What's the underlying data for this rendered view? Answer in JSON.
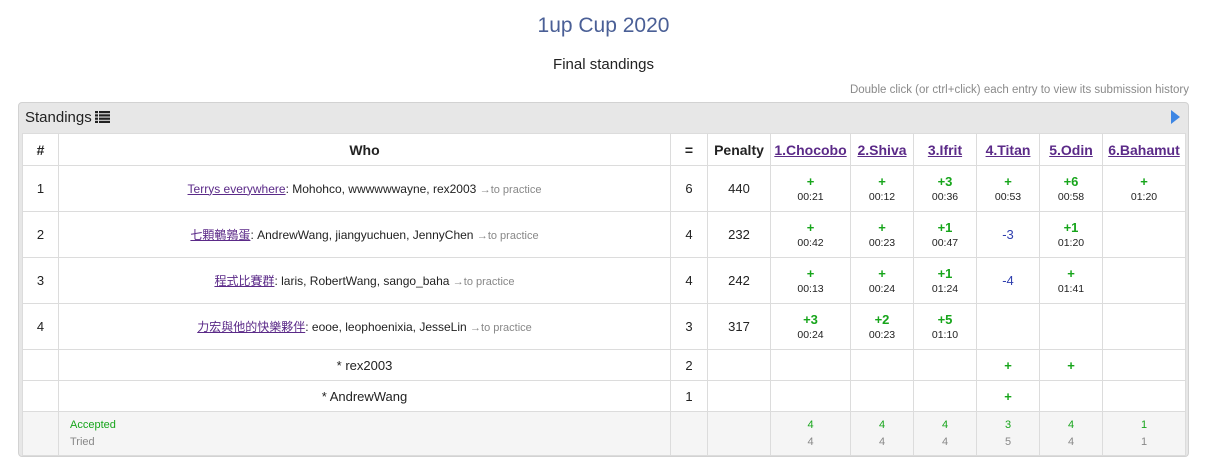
{
  "page": {
    "title": "1up Cup 2020",
    "subtitle": "Final standings",
    "hint": "Double click (or ctrl+click) each entry to view its submission history"
  },
  "panel": {
    "header": "Standings"
  },
  "columns": {
    "rank": "#",
    "who": "Who",
    "solved": "=",
    "penalty": "Penalty",
    "problems": [
      "1.Chocobo",
      "2.Shiva",
      "3.Ifrit",
      "4.Titan",
      "5.Odin",
      "6.Bahamut"
    ]
  },
  "rows": [
    {
      "rank": "1",
      "team": "Terrys everywhere",
      "members": ": Mohohco, wwwwwwayne, rex2003",
      "practice": "→to practice",
      "solved": "6",
      "penalty": "440",
      "cells": [
        {
          "res": "+",
          "time": "00:21"
        },
        {
          "res": "+",
          "time": "00:12"
        },
        {
          "res": "+3",
          "time": "00:36"
        },
        {
          "res": "+",
          "time": "00:53"
        },
        {
          "res": "+6",
          "time": "00:58"
        },
        {
          "res": "+",
          "time": "01:20"
        }
      ]
    },
    {
      "rank": "2",
      "team": "七顆鵪鶉蛋",
      "members": ": AndrewWang, jiangyuchuen, JennyChen",
      "practice": "→to practice",
      "solved": "4",
      "penalty": "232",
      "cells": [
        {
          "res": "+",
          "time": "00:42"
        },
        {
          "res": "+",
          "time": "00:23"
        },
        {
          "res": "+1",
          "time": "00:47"
        },
        {
          "res": "-3",
          "time": ""
        },
        {
          "res": "+1",
          "time": "01:20"
        },
        {
          "res": "",
          "time": ""
        }
      ]
    },
    {
      "rank": "3",
      "team": "程式比賽群",
      "members": ": laris, RobertWang, sango_baha",
      "practice": "→to practice",
      "solved": "4",
      "penalty": "242",
      "cells": [
        {
          "res": "+",
          "time": "00:13"
        },
        {
          "res": "+",
          "time": "00:24"
        },
        {
          "res": "+1",
          "time": "01:24"
        },
        {
          "res": "-4",
          "time": ""
        },
        {
          "res": "+",
          "time": "01:41"
        },
        {
          "res": "",
          "time": ""
        }
      ]
    },
    {
      "rank": "4",
      "team": "力宏與他的快樂夥伴",
      "members": ": eooe, leophoenixia, JesseLin",
      "practice": "→to practice",
      "solved": "3",
      "penalty": "317",
      "cells": [
        {
          "res": "+3",
          "time": "00:24"
        },
        {
          "res": "+2",
          "time": "00:23"
        },
        {
          "res": "+5",
          "time": "01:10"
        },
        {
          "res": "",
          "time": ""
        },
        {
          "res": "",
          "time": ""
        },
        {
          "res": "",
          "time": ""
        }
      ]
    }
  ],
  "individuals": [
    {
      "name": "* rex2003",
      "solved": "2",
      "cells": [
        "",
        "",
        "",
        "+",
        "+",
        ""
      ]
    },
    {
      "name": "* AndrewWang",
      "solved": "1",
      "cells": [
        "",
        "",
        "",
        "+",
        "",
        ""
      ]
    }
  ],
  "footer": {
    "accepted_label": "Accepted",
    "tried_label": "Tried",
    "accepted": [
      "4",
      "4",
      "4",
      "3",
      "4",
      "1"
    ],
    "tried": [
      "4",
      "4",
      "4",
      "5",
      "4",
      "1"
    ]
  },
  "colors": {
    "accepted": "#17a51b",
    "rejected": "#2f3fae",
    "link": "#5b2a88",
    "title": "#4a5f96",
    "expand": "#3d86e4"
  }
}
